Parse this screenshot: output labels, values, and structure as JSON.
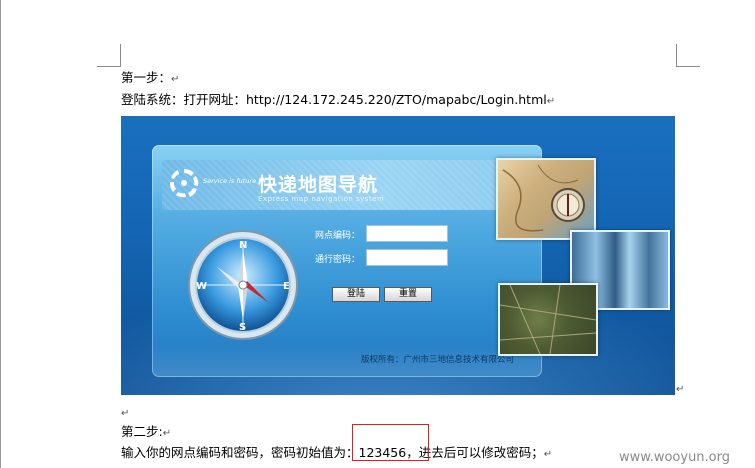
{
  "document": {
    "step1_title": "第一步：",
    "step1_text": "登陆系统：打开网址：http://124.172.245.220/ZTO/mapabc/Login.html",
    "step2_title": "第二步:",
    "step2_text": "输入你的网点编码和密码，密码初始值为：123456，进去后可以修改密码；",
    "paragraph_mark": "↵"
  },
  "login_app": {
    "slogan": "Service is future",
    "title": "快递地图导航",
    "subtitle": "Express map navigation system",
    "site_code_label": "网点编码：",
    "site_code_value": "",
    "password_label": "通行密码：",
    "password_value": "",
    "login_button": "登陆",
    "reset_button": "重置",
    "copyright": "版权所有：广州市三地信息技术有限公司",
    "compass_letters": {
      "n": "N",
      "s": "S",
      "e": "E",
      "w": "W"
    }
  },
  "watermark": "www.wooyun.org",
  "colors": {
    "background_blue": "#1466b4",
    "panel_blue": "#56aee3",
    "highlight_red": "#d62222"
  }
}
